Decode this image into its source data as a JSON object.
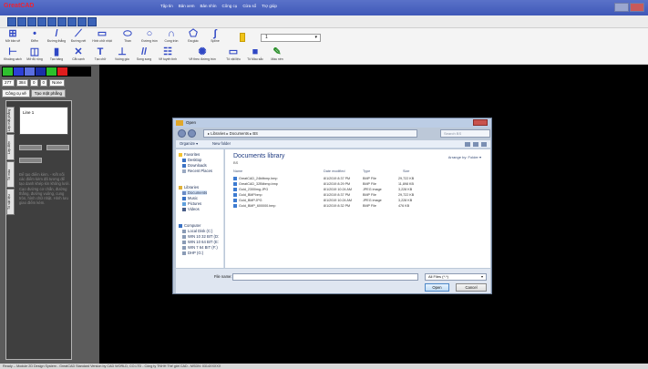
{
  "app": {
    "title": "GreatCAD"
  },
  "menu": [
    "Tập tin",
    "Bản xem",
    "Bản nhìn",
    "Công cụ",
    "Cửa sổ",
    "Trợ giúp"
  ],
  "toolbar_row1": [
    {
      "icon": "grid-icon",
      "label": "Mở bản vẽ"
    },
    {
      "icon": "point-icon",
      "label": "Điểm"
    },
    {
      "icon": "line-icon",
      "label": "Đường thẳng"
    },
    {
      "icon": "polyline-icon",
      "label": "Đường nét"
    },
    {
      "icon": "rectangle-icon",
      "label": "Hình chữ nhật"
    },
    {
      "icon": "ellipse-icon",
      "label": "Than"
    },
    {
      "icon": "circle-icon",
      "label": "Đường tròn"
    },
    {
      "icon": "arc-icon",
      "label": "Cung tròn"
    },
    {
      "icon": "polygon-icon",
      "label": "Đa giác"
    },
    {
      "icon": "spline-icon",
      "label": "Spline"
    }
  ],
  "toolbar_row2": [
    {
      "icon": "distance-icon",
      "label": "Khoảng cách"
    },
    {
      "icon": "offset-icon",
      "label": "Mở độ rộng"
    },
    {
      "icon": "split-icon",
      "label": "Tạo bảng"
    },
    {
      "icon": "cross-icon",
      "label": "Cắt cạnh"
    },
    {
      "icon": "text-icon",
      "label": "Tạo chữ"
    },
    {
      "icon": "perpendicular-icon",
      "label": "Vuông góc"
    },
    {
      "icon": "parallel-icon",
      "label": "Song song"
    },
    {
      "icon": "hatch-icon",
      "label": "Vẽ tuyến tính"
    },
    {
      "icon": "gear-icon",
      "label": "Vẽ theo đường tròn"
    },
    {
      "icon": "material-icon",
      "label": "Tô vật liệu"
    },
    {
      "icon": "color-icon",
      "label": "Tô Màu sắc"
    },
    {
      "icon": "erase-icon",
      "label": "Màu nền"
    }
  ],
  "layer_select": {
    "value": "1"
  },
  "left_panel": {
    "coords": [
      "277",
      "384",
      "0",
      "0",
      "None"
    ],
    "tabs": [
      "Công cụ vẽ",
      "Tạo mặt phẳng"
    ],
    "vertical_tabs": [
      "Lớp mặt phẳng",
      "Lớp điện",
      "Tô màu",
      "Tô vật liệu"
    ],
    "line_item": "Line 1",
    "hint": "Để tạo điểm kèm. - Kết nối các điểm kèm đã tương để tạo danh khép kín không lưới. Cao đường cơ chắn, đường thẳng, đường vuông, cung tròn, hình chữ nhật. Hình lưu giao điểm kèm."
  },
  "dialog": {
    "title": "Open",
    "address": "▸ Libraries ▸ Documents ▸ BS",
    "search_placeholder": "Search BS",
    "organize": "Organize ▾",
    "new_folder": "New folder",
    "nav": {
      "favorites": "Favorites",
      "desktop": "Desktop",
      "downloads": "Downloads",
      "recent": "Recent Places",
      "libraries": "Libraries",
      "documents": "Documents",
      "music": "Music",
      "pictures": "Pictures",
      "videos": "Videos",
      "computer": "Computer",
      "local_disk": "Local Disk (C:)",
      "win1": "WIN 10 32 BIT (D:",
      "win2": "WIN 10 64 BIT (E:",
      "win3": "WIN 7 64 BIT (F:)",
      "dhp": "DHP (G:)"
    },
    "library_title": "Documents library",
    "library_sub": "BS",
    "arrange_by": "Arrange by:  Folder ▾",
    "columns": {
      "name": "Name",
      "date": "Date modified",
      "type": "Type",
      "size": "Size"
    },
    "files": [
      {
        "name": "GreatCAD_24bitbmp.bmp",
        "date": "8/1/2019 8:37 PM",
        "type": "BMP File",
        "size": "29,722 KB"
      },
      {
        "name": "GreatCAD_32Bitbmp.bmp",
        "date": "8/1/2019 8:29 PM",
        "type": "BMP File",
        "size": "11,898 KB"
      },
      {
        "name": "Gold_2300img.JPG",
        "date": "8/1/2019 10:24 AM",
        "type": "JPEG image",
        "size": "3,228 KB"
      },
      {
        "name": "Gold_BMP.bmp",
        "date": "8/1/2019 8:37 PM",
        "type": "BMP File",
        "size": "29,722 KB"
      },
      {
        "name": "Gold_BMP.JPG",
        "date": "8/1/2019 10:24 AM",
        "type": "JPEG image",
        "size": "3,228 KB"
      },
      {
        "name": "Gold_BMP_600000.bmp",
        "date": "8/1/2019 8:32 PM",
        "type": "BMP File",
        "size": "476 KB"
      }
    ],
    "file_name_label": "File name:",
    "filter_value": "All Files (*.*)",
    "open_label": "Open",
    "cancel_label": "Cancel"
  },
  "status_bar": "Ready -- Module 2D Design System - GreatCAD Standard Version by CAD WORLD, CO.LTD - Công ty TNHH Thế giới CAD - MSDN: 0314XXXXX"
}
